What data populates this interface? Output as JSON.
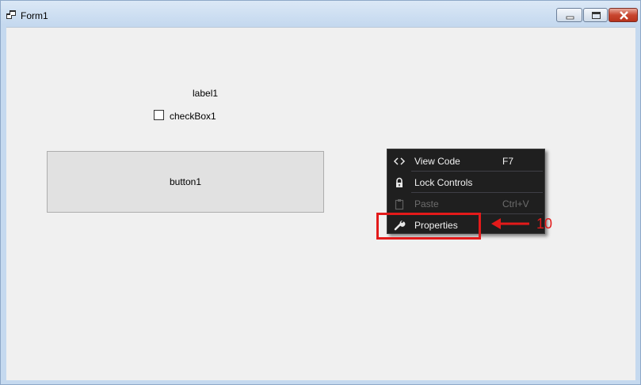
{
  "window": {
    "title": "Form1"
  },
  "form": {
    "label1": "label1",
    "checkbox_label": "checkBox1",
    "checkbox_checked": false,
    "button1": "button1"
  },
  "context_menu": {
    "items": [
      {
        "label": "View Code",
        "shortcut": "F7",
        "icon": "code-brackets-icon",
        "enabled": true
      },
      {
        "label": "Lock Controls",
        "shortcut": "",
        "icon": "lock-icon",
        "enabled": true
      },
      {
        "label": "Paste",
        "shortcut": "Ctrl+V",
        "icon": "clipboard-icon",
        "enabled": false
      },
      {
        "label": "Properties",
        "shortcut": "",
        "icon": "wrench-icon",
        "enabled": true
      }
    ]
  },
  "annotation": {
    "step_number": "10",
    "color": "#e31a1a"
  }
}
